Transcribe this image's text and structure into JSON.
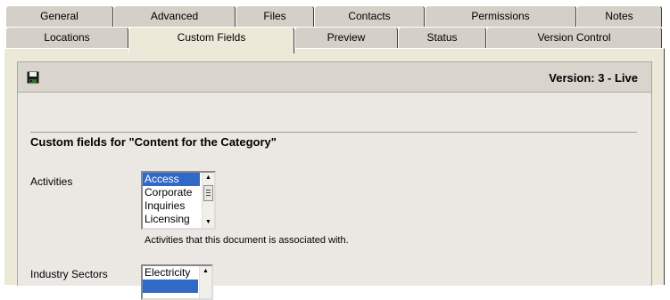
{
  "tabs_row1": [
    "General",
    "Advanced",
    "Files",
    "Contacts",
    "Permissions",
    "Notes"
  ],
  "tabs_row2": [
    "Locations",
    "Custom Fields",
    "Preview",
    "Status",
    "Version Control"
  ],
  "active_tab": "Custom Fields",
  "toolbar": {
    "save_icon": "save-disk-icon",
    "version": "Version: 3 - Live"
  },
  "section": {
    "title": "Custom fields for \"Content for the Category\""
  },
  "fields": {
    "activities": {
      "label": "Activities",
      "options": [
        "Access",
        "Corporate",
        "Inquiries",
        "Licensing"
      ],
      "selected": "Access",
      "help": "Activities that this document is associated with."
    },
    "industry_sectors": {
      "label": "Industry Sectors",
      "options": [
        "Electricity"
      ]
    }
  },
  "colors": {
    "selection": "#3169c6",
    "tab_face": "#d4d0c8",
    "panel": "#ece9d8"
  }
}
